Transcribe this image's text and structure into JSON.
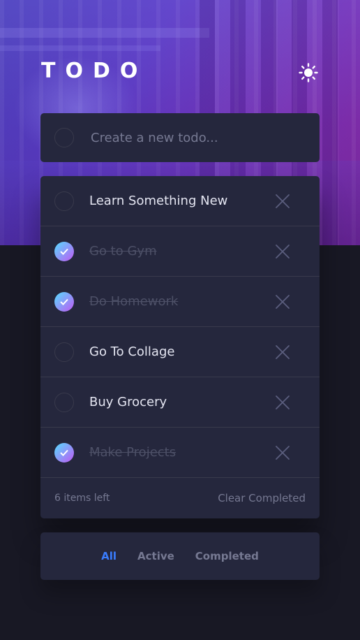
{
  "header": {
    "title": "TODO",
    "theme_toggle_icon": "sun-icon"
  },
  "new_todo": {
    "placeholder": "Create a new todo...",
    "value": ""
  },
  "todos": [
    {
      "text": "Learn Something New",
      "completed": false
    },
    {
      "text": "Go to Gym",
      "completed": true
    },
    {
      "text": "Do Homework",
      "completed": true
    },
    {
      "text": "Go To Collage",
      "completed": false
    },
    {
      "text": "Buy Grocery",
      "completed": false
    },
    {
      "text": "Make Projects",
      "completed": true
    }
  ],
  "footer": {
    "items_left": "6 items left",
    "clear_label": "Clear Completed"
  },
  "filters": {
    "all": "All",
    "active": "Active",
    "completed": "Completed",
    "selected": "All"
  },
  "colors": {
    "accent": "#3a7cfd",
    "check_gradient_start": "#55ddff",
    "check_gradient_end": "#c058f3",
    "card_bg": "#25273d",
    "page_bg": "#181824"
  }
}
